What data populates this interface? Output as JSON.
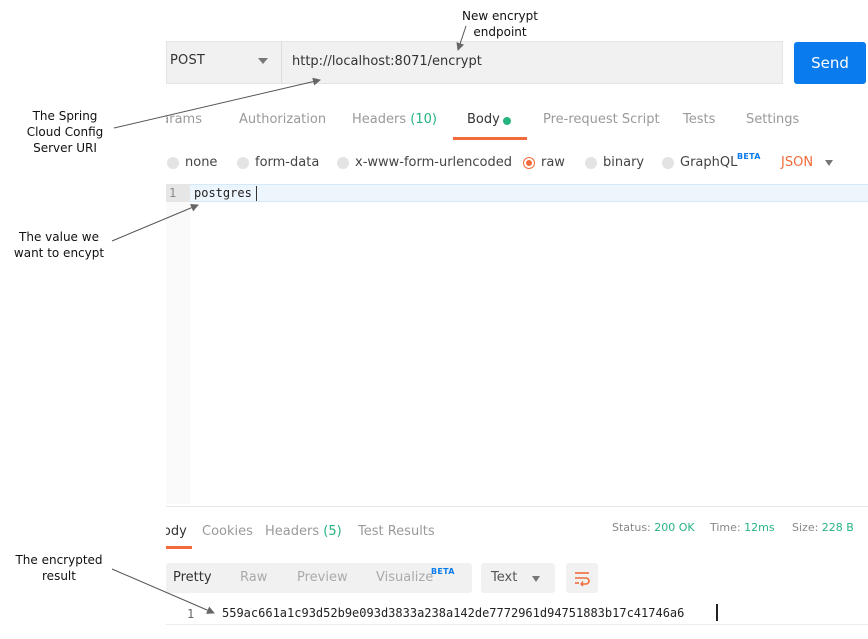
{
  "request": {
    "method": "POST",
    "url": "http://localhost:8071/encrypt",
    "send_label": "Send"
  },
  "tabs": [
    {
      "label": "Params"
    },
    {
      "label": "Authorization"
    },
    {
      "label": "Headers",
      "count": "(10)"
    },
    {
      "label": "Body"
    },
    {
      "label": "Pre-request Script"
    },
    {
      "label": "Tests"
    },
    {
      "label": "Settings"
    }
  ],
  "body_options": {
    "none": "none",
    "form_data": "form-data",
    "urlencoded": "x-www-form-urlencoded",
    "raw": "raw",
    "binary": "binary",
    "graphql": "GraphQL",
    "beta": "BETA",
    "format": "JSON"
  },
  "editor": {
    "line_number": "1",
    "content": "postgres"
  },
  "response": {
    "tabs": [
      {
        "label": "Body"
      },
      {
        "label": "Cookies"
      },
      {
        "label": "Headers",
        "count": "(5)"
      },
      {
        "label": "Test Results"
      }
    ],
    "status_label": "Status:",
    "status_value": "200 OK",
    "time_label": "Time:",
    "time_value": "12ms",
    "size_label": "Size:",
    "size_value": "228 B",
    "views": {
      "pretty": "Pretty",
      "raw": "Raw",
      "preview": "Preview",
      "visualize": "Visualize",
      "beta": "BETA"
    },
    "format": "Text",
    "line_number": "1",
    "content": "559ac661a1c93d52b9e093d3833a238a142de7772961d94751883b17c41746a6"
  },
  "annotations": {
    "endpoint": [
      "New encrypt",
      "endpoint"
    ],
    "uri": [
      "The Spring",
      "Cloud Config",
      "Server URI"
    ],
    "value": [
      "The value we",
      "want to encypt"
    ],
    "result": [
      "The encrypted",
      "result"
    ]
  },
  "colors": {
    "accent": "#f26b3a",
    "send": "#097bed",
    "success": "#26b47f"
  }
}
